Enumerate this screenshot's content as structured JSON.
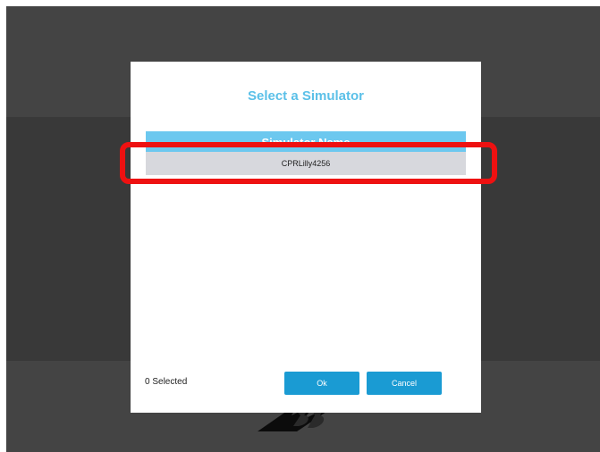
{
  "dialog": {
    "title": "Select a Simulator",
    "table": {
      "column_header": "Simulator Name",
      "rows": [
        {
          "name": "CPRLilly4256"
        }
      ]
    },
    "selected_count_text": "0 Selected",
    "ok_label": "Ok",
    "cancel_label": "Cancel"
  },
  "colors": {
    "accent": "#5bc0e8",
    "header_bg": "#6cc8ef",
    "button_bg": "#1a9bd3",
    "row_bg": "#d7d8dd",
    "highlight": "#ee1111"
  },
  "icons": {
    "brand_logo": "3b-logo"
  }
}
